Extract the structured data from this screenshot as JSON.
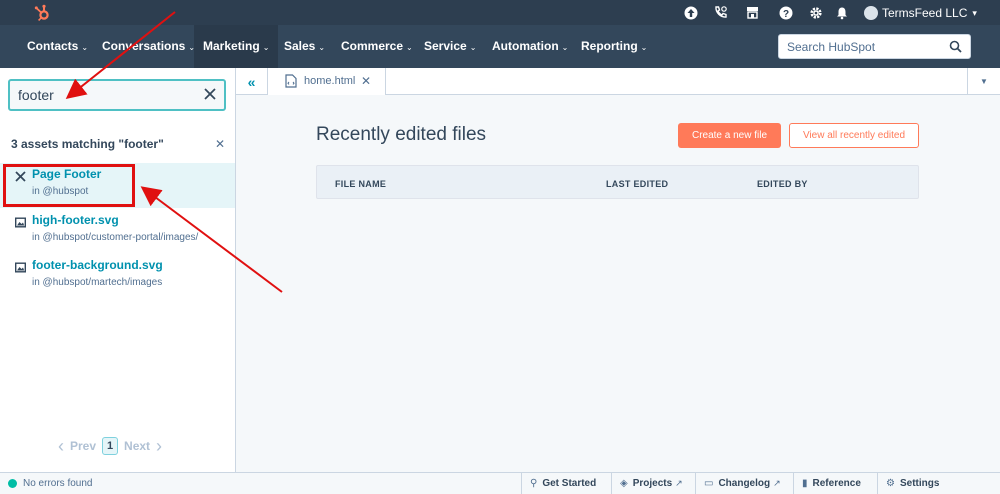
{
  "topbar": {
    "account_name": "TermsFeed LLC",
    "icons": [
      "upgrade-icon",
      "calling-icon",
      "marketplace-icon",
      "help-icon",
      "settings-gear-icon",
      "notifications-bell-icon"
    ]
  },
  "nav": {
    "items": [
      {
        "label": "Contacts"
      },
      {
        "label": "Conversations"
      },
      {
        "label": "Marketing"
      },
      {
        "label": "Sales"
      },
      {
        "label": "Commerce"
      },
      {
        "label": "Service"
      },
      {
        "label": "Automation"
      },
      {
        "label": "Reporting"
      }
    ],
    "active": "Marketing",
    "search_placeholder": "Search HubSpot"
  },
  "left_panel": {
    "search_value": "footer",
    "match_title": "3 assets matching \"footer\"",
    "results": [
      {
        "name": "Page Footer",
        "path": "in @hubspot",
        "icon": "module-icon",
        "selected": true
      },
      {
        "name": "high-footer.svg",
        "path": "in @hubspot/customer-portal/images/",
        "icon": "image-icon",
        "selected": false
      },
      {
        "name": "footer-background.svg",
        "path": "in @hubspot/martech/images",
        "icon": "image-icon",
        "selected": false
      }
    ],
    "pagination": {
      "prev": "Prev",
      "current": "1",
      "next": "Next"
    }
  },
  "workspace": {
    "tab_label": "home.html",
    "title": "Recently edited files",
    "create_button": "Create a new file",
    "view_all_button": "View all recently edited",
    "table_headers": [
      "FILE NAME",
      "LAST EDITED",
      "EDITED BY"
    ]
  },
  "footer": {
    "status": "No errors found",
    "links": [
      {
        "label": "Get Started",
        "icon": "get-started-icon"
      },
      {
        "label": "Projects",
        "icon": "projects-icon"
      },
      {
        "label": "Changelog",
        "icon": "changelog-icon"
      },
      {
        "label": "Reference",
        "icon": "reference-icon"
      },
      {
        "label": "Settings",
        "icon": "settings-icon"
      }
    ]
  },
  "colors": {
    "topbar": "#2d3e50",
    "navbar": "#33475b",
    "accent_teal": "#0091ae",
    "accent_orange": "#ff7a59",
    "annotation_red": "#e01010"
  }
}
